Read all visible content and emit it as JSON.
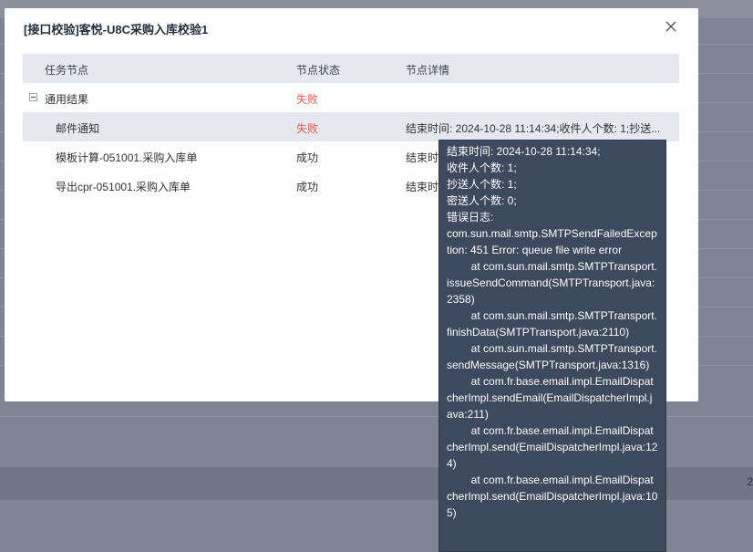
{
  "background": {
    "edge_text": "2"
  },
  "dialog": {
    "title": "[接口校验]客悦-U8C采购入库校验1",
    "close_label": "×"
  },
  "table": {
    "headers": [
      "任务节点",
      "节点状态",
      "节点详情"
    ],
    "rows": [
      {
        "node": "通用结果",
        "status": "失败",
        "detail": ""
      },
      {
        "node": "邮件通知",
        "status": "失败",
        "detail": "结束时间: 2024-10-28 11:14:34;收件人个数: 1;抄送..."
      },
      {
        "node": "模板计算-051001.采购入库单",
        "status": "成功",
        "detail": "结束时"
      },
      {
        "node": "导出cpr-051001.采购入库单",
        "status": "成功",
        "detail": "结束时"
      }
    ]
  },
  "tooltip": {
    "lines": [
      "结束时间: 2024-10-28 11:14:34;",
      "收件人个数: 1;",
      "抄送人个数: 1;",
      "密送人个数: 0;",
      "错误日志:",
      "com.sun.mail.smtp.SMTPSendFailedException: 451 Error: queue file write error",
      "        at com.sun.mail.smtp.SMTPTransport.issueSendCommand(SMTPTransport.java:2358)",
      "        at com.sun.mail.smtp.SMTPTransport.finishData(SMTPTransport.java:2110)",
      "        at com.sun.mail.smtp.SMTPTransport.sendMessage(SMTPTransport.java:1316)",
      "        at com.fr.base.email.impl.EmailDispatcherImpl.sendEmail(EmailDispatcherImpl.java:211)",
      "        at com.fr.base.email.impl.EmailDispatcherImpl.send(EmailDispatcherImpl.java:124)",
      "        at com.fr.base.email.impl.EmailDispatcherImpl.send(EmailDispatcherImpl.java:105)"
    ]
  }
}
